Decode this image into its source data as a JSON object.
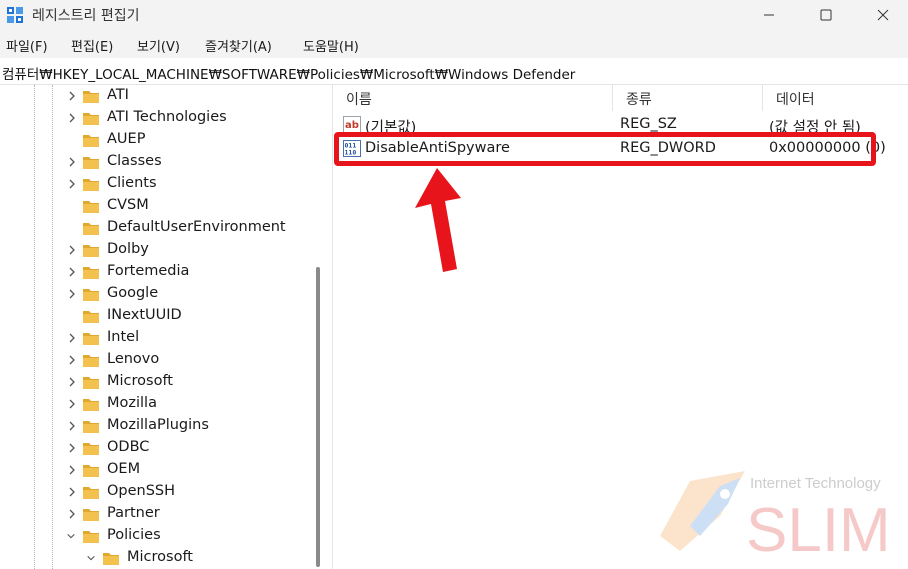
{
  "window": {
    "title": "레지스트리 편집기"
  },
  "menu": [
    "파일(F)",
    "편집(E)",
    "보기(V)",
    "즐겨찾기(A)",
    "도움말(H)"
  ],
  "address": "컴퓨터₩HKEY_LOCAL_MACHINE₩SOFTWARE₩Policies₩Microsoft₩Windows Defender",
  "tree": [
    {
      "label": "ATI",
      "chevron": "right"
    },
    {
      "label": "ATI Technologies",
      "chevron": "right"
    },
    {
      "label": "AUEP",
      "chevron": "none"
    },
    {
      "label": "Classes",
      "chevron": "right"
    },
    {
      "label": "Clients",
      "chevron": "right"
    },
    {
      "label": "CVSM",
      "chevron": "none"
    },
    {
      "label": "DefaultUserEnvironment",
      "chevron": "none"
    },
    {
      "label": "Dolby",
      "chevron": "right"
    },
    {
      "label": "Fortemedia",
      "chevron": "right"
    },
    {
      "label": "Google",
      "chevron": "right"
    },
    {
      "label": "INextUUID",
      "chevron": "none"
    },
    {
      "label": "Intel",
      "chevron": "right"
    },
    {
      "label": "Lenovo",
      "chevron": "right"
    },
    {
      "label": "Microsoft",
      "chevron": "right"
    },
    {
      "label": "Mozilla",
      "chevron": "right"
    },
    {
      "label": "MozillaPlugins",
      "chevron": "right"
    },
    {
      "label": "ODBC",
      "chevron": "right"
    },
    {
      "label": "OEM",
      "chevron": "right"
    },
    {
      "label": "OpenSSH",
      "chevron": "right"
    },
    {
      "label": "Partner",
      "chevron": "right"
    },
    {
      "label": "Policies",
      "chevron": "down"
    },
    {
      "label": "Microsoft",
      "chevron": "down"
    }
  ],
  "list": {
    "headers": [
      "이름",
      "종류",
      "데이터"
    ],
    "rows": [
      {
        "icon": "string-value-icon",
        "name": "(기본값)",
        "type": "REG_SZ",
        "data": "(값 설정 안 됨)"
      },
      {
        "icon": "dword-value-icon",
        "name": "DisableAntiSpyware",
        "type": "REG_DWORD",
        "data": "0x00000000 (0)"
      }
    ]
  },
  "annotation": {
    "highlight_color": "#e8141c",
    "arrow_color": "#e8141c"
  },
  "watermark": {
    "line1": "Internet Technology",
    "line2": "SLIM"
  },
  "colors": {
    "folder": "#f2c14e",
    "folder_dark": "#e0a82e"
  }
}
